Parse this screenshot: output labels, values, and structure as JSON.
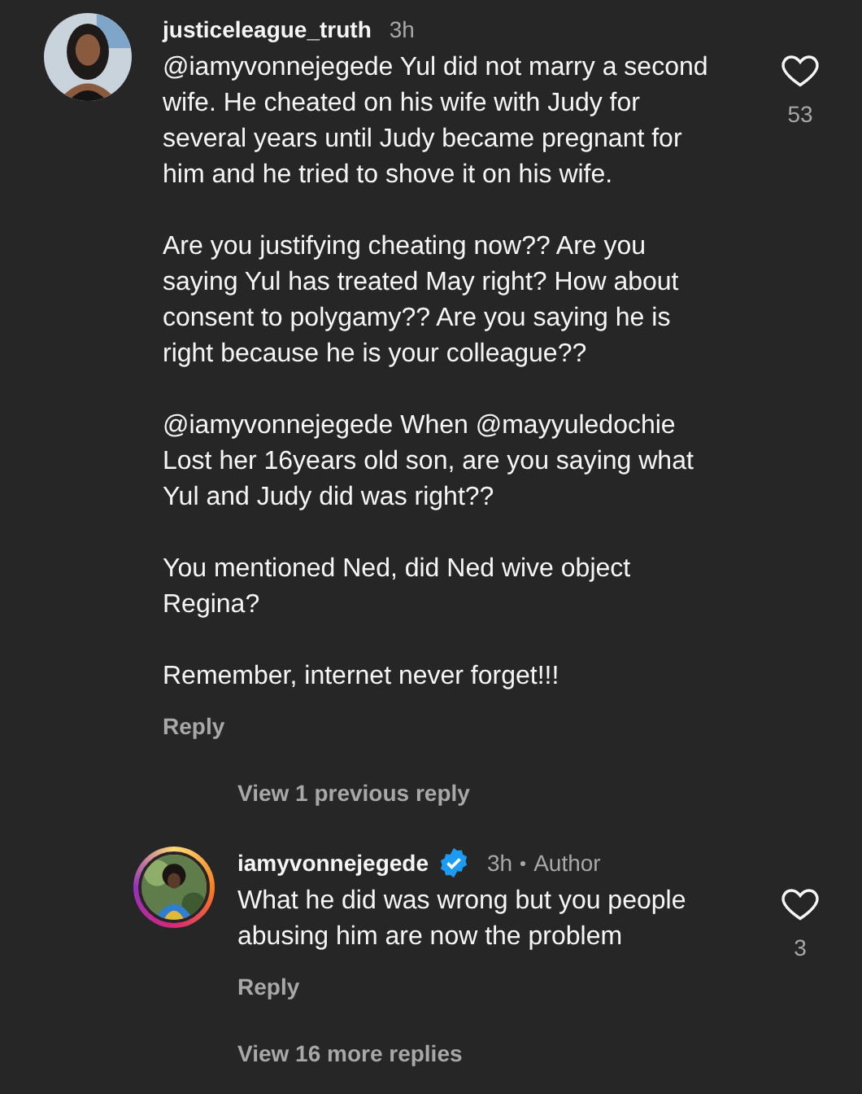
{
  "comment": {
    "username": "justiceleague_truth",
    "verified": false,
    "time": "3h",
    "paragraphs": [
      "@iamyvonnejegede Yul did not marry a second wife. He cheated on his wife with Judy for several years until Judy became pregnant for him and he tried to shove it on his wife.",
      "Are you justifying cheating now?? Are you saying Yul has treated May right? How about consent to polygamy?? Are you saying he is right because he is your colleague??",
      "@iamyvonnejegede When @mayyuledochie Lost her 16years old son, are you saying what Yul and Judy did was right??",
      "You mentioned Ned, did Ned wive object Regina?",
      "Remember, internet never forget!!!"
    ],
    "liked": false,
    "like_count": "53",
    "reply_label": "Reply"
  },
  "previous_replies_link": "View 1 previous reply",
  "reply": {
    "username": "iamyvonnejegede",
    "verified": true,
    "time": "3h",
    "author_label": "Author",
    "paragraphs": [
      "What he did was wrong but you people abusing him are now the problem"
    ],
    "liked": false,
    "like_count": "3",
    "reply_label": "Reply"
  },
  "more_replies_link": "View 16 more replies"
}
